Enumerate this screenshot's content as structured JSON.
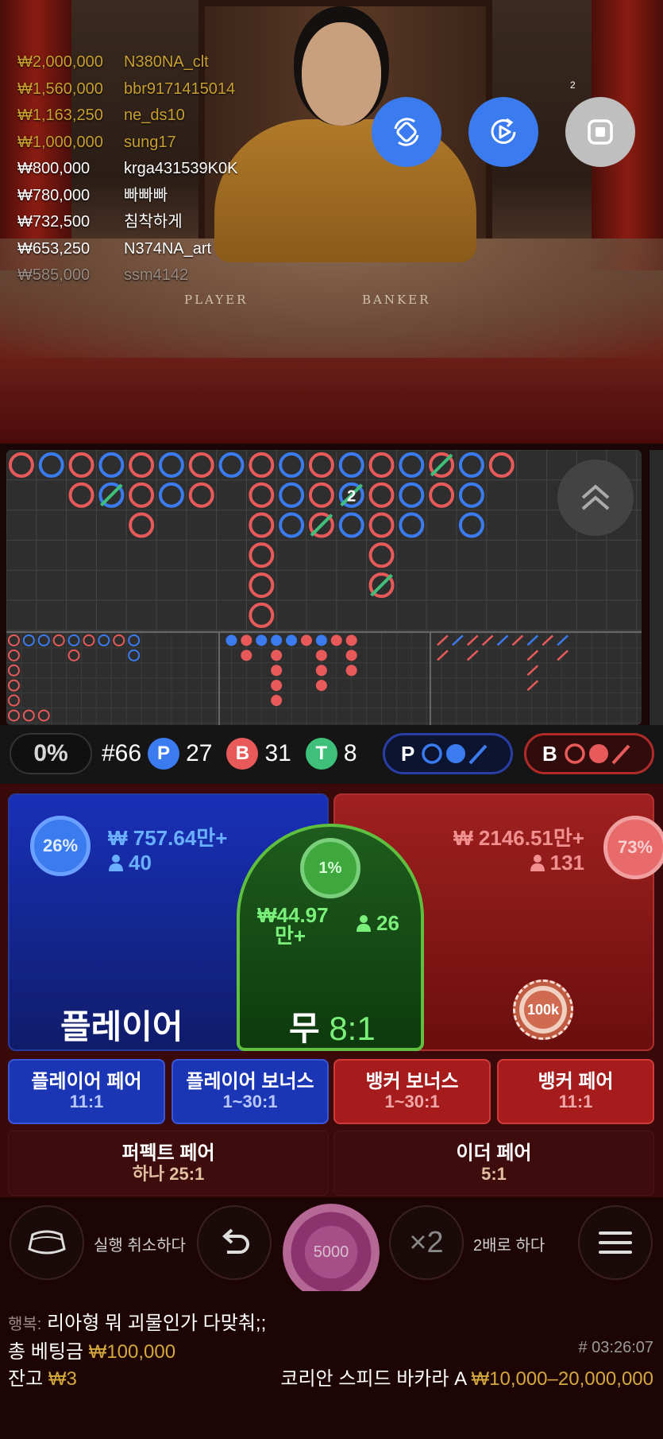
{
  "leaderboard": [
    {
      "amount": "₩2,000,000",
      "name": "N380NA_clt",
      "color": "#c8a030"
    },
    {
      "amount": "₩1,560,000",
      "name": "bbr9171415014",
      "color": "#c8a030"
    },
    {
      "amount": "₩1,163,250",
      "name": "ne_ds10",
      "color": "#c8a030"
    },
    {
      "amount": "₩1,000,000",
      "name": "sung17",
      "color": "#c8a030"
    },
    {
      "amount": "₩800,000",
      "name": "krga431539K0K",
      "color": "#ffffff"
    },
    {
      "amount": "₩780,000",
      "name": "빠빠빠",
      "color": "#ffffff"
    },
    {
      "amount": "₩732,500",
      "name": "침착하게",
      "color": "#ffffff"
    },
    {
      "amount": "₩653,250",
      "name": "N374NA_art",
      "color": "#ffffff"
    },
    {
      "amount": "₩585,000",
      "name": "ssm4142",
      "color": "#9a8a80"
    }
  ],
  "video": {
    "player_label": "PLAYER",
    "banker_label": "BANKER",
    "viewer_count": "2",
    "icons": [
      "rotate-camera-icon",
      "replay-video-icon",
      "stop-icon"
    ]
  },
  "roads": {
    "big_road_marker": "2",
    "toggle_icon": "chevron-up-double-icon"
  },
  "stats": {
    "percent": "0%",
    "round": "#66",
    "p_letter": "P",
    "p_count": "27",
    "b_letter": "B",
    "b_count": "31",
    "t_letter": "T",
    "t_count": "8",
    "ask_p": "P",
    "ask_b": "B"
  },
  "bets": {
    "player": {
      "pct": "26%",
      "amount": "₩ 757.64만+",
      "count": "40",
      "name": "플레이어"
    },
    "tie": {
      "pct": "1%",
      "amount_line1": "₩44.97",
      "amount_line2": "만+",
      "count": "26",
      "name": "무",
      "odds": "8:1"
    },
    "banker": {
      "pct": "73%",
      "amount": "₩ 2146.51만+",
      "count": "131",
      "chip": "100k"
    }
  },
  "side_bets": [
    {
      "name": "플레이어 페어",
      "odds": "11:1",
      "color": "blue"
    },
    {
      "name": "플레이어 보너스",
      "odds": "1~30:1",
      "color": "blue"
    },
    {
      "name": "뱅커 보너스",
      "odds": "1~30:1",
      "color": "red"
    },
    {
      "name": "뱅커 페어",
      "odds": "11:1",
      "color": "red"
    }
  ],
  "wide_bets": [
    {
      "name": "퍼펙트 페어",
      "odds": "하나 25:1"
    },
    {
      "name": "이더 페어",
      "odds": "5:1"
    }
  ],
  "controls": {
    "undo_label": "실행 취소하다",
    "chip_value": "5000",
    "double_symbol": "×2",
    "double_label": "2배로 하다"
  },
  "footer": {
    "chat_user": "행복:",
    "chat_message": "리아형 뭐 괴물인가 다맞춰;;",
    "total_bet_label": "총 베팅금",
    "total_bet_value": "₩100,000",
    "balance_label": "잔고",
    "balance_value": "₩3",
    "round_id": "# 03:26:07",
    "table_name": "코리안 스피드 바카라 A",
    "table_limits": "₩10,000–20,000,000"
  },
  "colors": {
    "player": "#3a7bf0",
    "banker": "#e85a5a",
    "tie": "#3ec07a",
    "gold": "#d4a83a"
  }
}
